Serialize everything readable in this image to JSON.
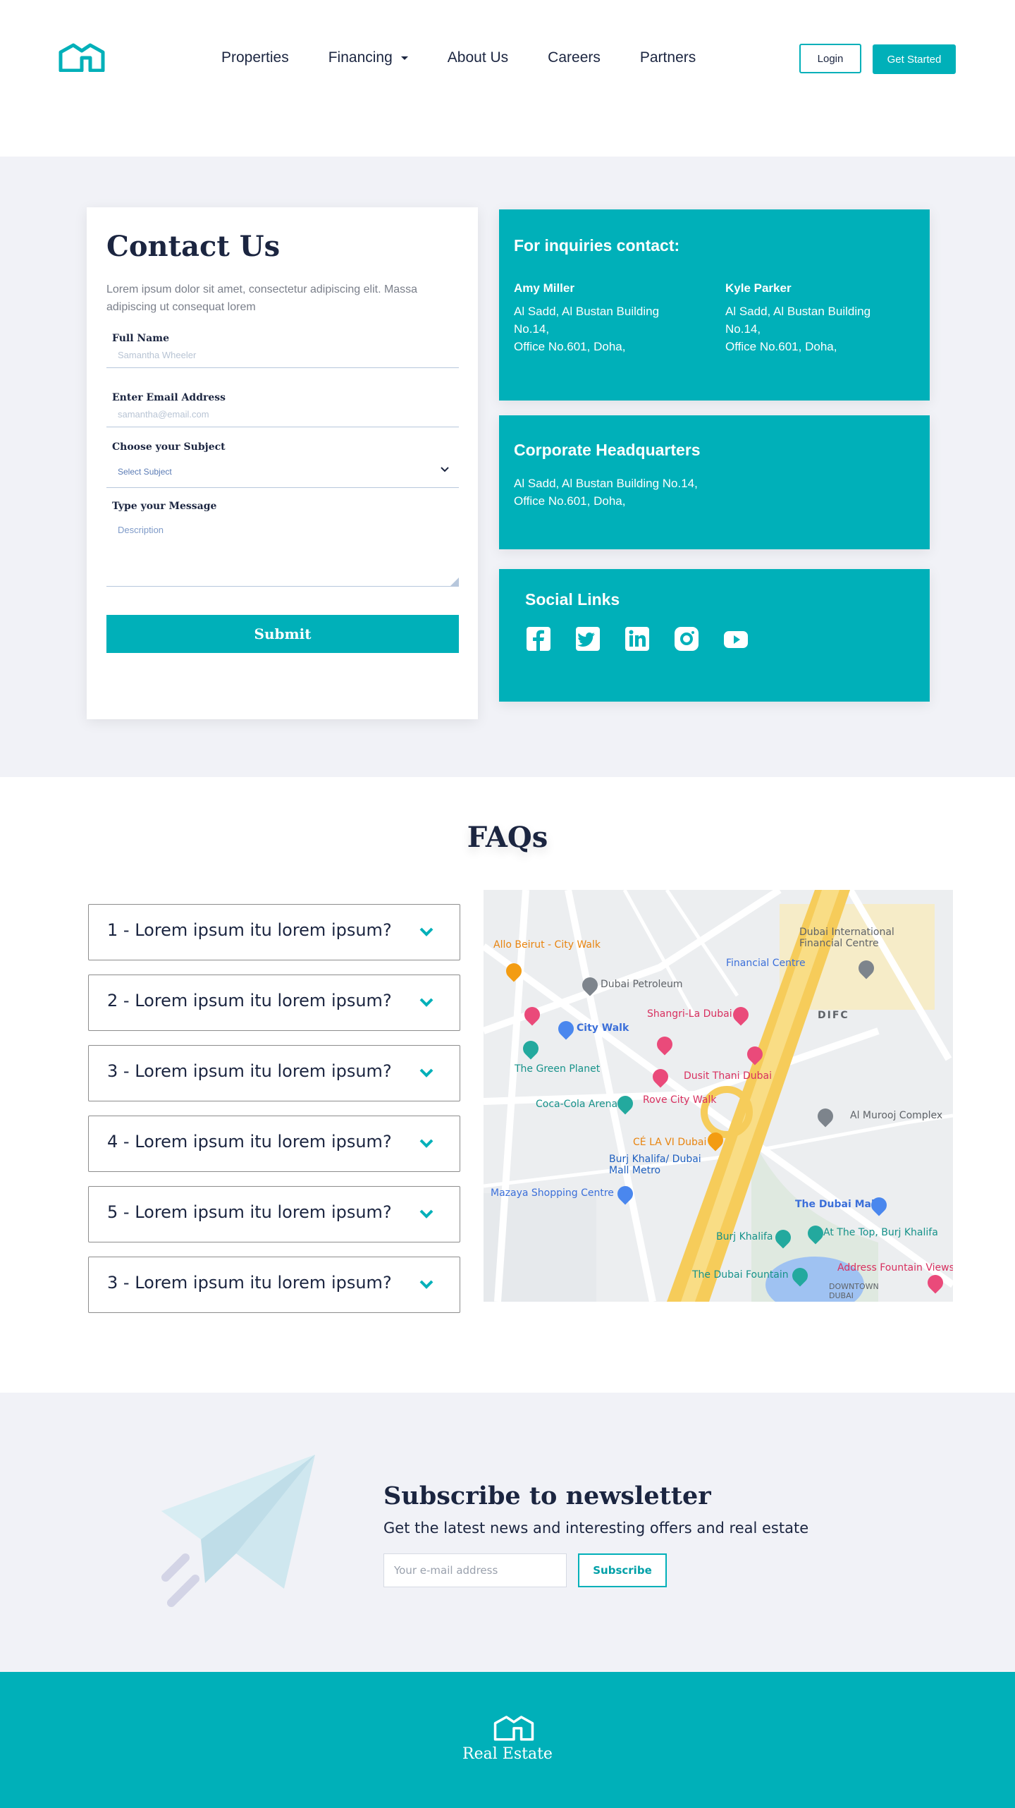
{
  "header": {
    "nav": [
      {
        "label": "Properties"
      },
      {
        "label": "Financing",
        "has_dropdown": true
      },
      {
        "label": "About Us"
      },
      {
        "label": "Careers"
      },
      {
        "label": "Partners"
      }
    ],
    "login_label": "Login",
    "get_started_label": "Get Started"
  },
  "contact": {
    "title": "Contact Us",
    "description": "Lorem ipsum dolor sit amet, consectetur adipiscing elit. Massa adipiscing ut consequat lorem",
    "full_name_label": "Full Name",
    "full_name_placeholder": "Samantha Wheeler",
    "email_label": "Enter Email Address",
    "email_placeholder": "samantha@email.com",
    "subject_label": "Choose your Subject",
    "subject_placeholder": "Select Subject",
    "message_label": "Type your Message",
    "message_placeholder": "Description",
    "submit_label": "Submit"
  },
  "inquiries": {
    "title": "For inquiries contact:",
    "people": [
      {
        "name": "Amy Miller",
        "address": [
          "Al Sadd, Al Bustan Building",
          "No.14,",
          "Office No.601, Doha,"
        ]
      },
      {
        "name": "Kyle Parker",
        "address": [
          "Al Sadd, Al Bustan Building",
          "No.14,",
          "Office No.601, Doha,"
        ]
      }
    ]
  },
  "headquarters": {
    "title": "Corporate Headquarters",
    "address": [
      "Al Sadd, Al Bustan Building No.14,",
      "Office No.601, Doha,"
    ]
  },
  "social": {
    "title": "Social Links",
    "icons": [
      "facebook-icon",
      "twitter-icon",
      "linkedin-icon",
      "instagram-icon",
      "youtube-icon"
    ]
  },
  "faq": {
    "title": "FAQs",
    "items": [
      {
        "question": "1 -  Lorem ipsum itu lorem ipsum?"
      },
      {
        "question": "2 -  Lorem ipsum itu lorem ipsum?"
      },
      {
        "question": "3 -  Lorem ipsum itu lorem ipsum?"
      },
      {
        "question": "4 -  Lorem ipsum itu lorem ipsum?"
      },
      {
        "question": "5 -  Lorem ipsum itu lorem ipsum?"
      },
      {
        "question": "3 -  Lorem ipsum itu lorem ipsum?"
      }
    ]
  },
  "map": {
    "labels": {
      "allo_beirut": "Allo Beirut - City Walk",
      "dubai_petroleum": "Dubai Petroleum",
      "city_walk": "City Walk",
      "green_planet": "The Green Planet",
      "coca_cola": "Coca-Cola Arena",
      "shangri_la": "Shangri-La Dubai",
      "dusit_thani": "Dusit Thani Dubai",
      "rove": "Rove City Walk",
      "ce_la_vi": "CÉ LA VI Dubai",
      "burj_metro": "Burj Khalifa/ Dubai Mall Metro",
      "mazaya": "Mazaya Shopping Centre",
      "difc_centre": "Dubai International Financial Centre",
      "financial_centre": "Financial Centre",
      "difc": "DIFC",
      "al_murooj": "Al Murooj Complex",
      "dubai_mall": "The Dubai Mall",
      "burj_khalifa": "Burj Khalifa",
      "at_the_top": "At The Top, Burj Khalifa",
      "fountain_views": "Address Fountain Views",
      "dubai_fountain": "The Dubai Fountain",
      "downtown": "DOWNTOWN DUBAI"
    }
  },
  "newsletter": {
    "title": "Subscribe to newsletter",
    "subtitle": "Get the latest news and interesting offers and real estate",
    "input_placeholder": "Your e-mail address",
    "button_label": "Subscribe"
  },
  "footer": {
    "brand": "Real Estate"
  },
  "colors": {
    "accent": "#00b0b9",
    "dark": "#1b2540",
    "section_bg": "#f1f2f7"
  }
}
